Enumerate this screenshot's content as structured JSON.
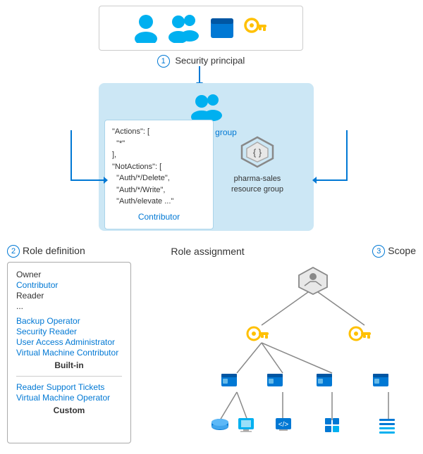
{
  "security_principal": {
    "label": "Security principal",
    "number": "1"
  },
  "role_assignment": {
    "group_name": "Marketing group",
    "role_code": {
      "line1": "\"Actions\": [",
      "line2": "  \"*\"",
      "line3": "],",
      "line4": "\"NotActions\": [",
      "line5": "  \"Auth/*/Delete\",",
      "line6": "  \"Auth/*/Write\",",
      "line7": "  \"Auth/elevate ...\""
    },
    "role_name": "Contributor",
    "resource_group_line1": "pharma-sales",
    "resource_group_line2": "resource group",
    "section_label": "Role assignment"
  },
  "role_definition": {
    "number": "2",
    "label": "Role definition",
    "items_builtin": [
      {
        "text": "Owner",
        "link": false
      },
      {
        "text": "Contributor",
        "link": true
      },
      {
        "text": "Reader",
        "link": false
      },
      {
        "text": "...",
        "link": false
      },
      {
        "text": "Backup Operator",
        "link": true
      },
      {
        "text": "Security Reader",
        "link": true
      },
      {
        "text": "User Access Administrator",
        "link": true
      },
      {
        "text": "Virtual Machine Contributor",
        "link": true
      }
    ],
    "builtin_label": "Built-in",
    "items_custom": [
      {
        "text": "Reader Support Tickets",
        "link": true
      },
      {
        "text": "Virtual Machine Operator",
        "link": true
      }
    ],
    "custom_label": "Custom"
  },
  "scope": {
    "number": "3",
    "label": "Scope"
  },
  "colors": {
    "blue": "#0078d4",
    "light_blue_bg": "#cce7f5",
    "icon_blue": "#00b0f0",
    "gold": "#ffc000",
    "gray": "#888",
    "dark_gray": "#555"
  }
}
